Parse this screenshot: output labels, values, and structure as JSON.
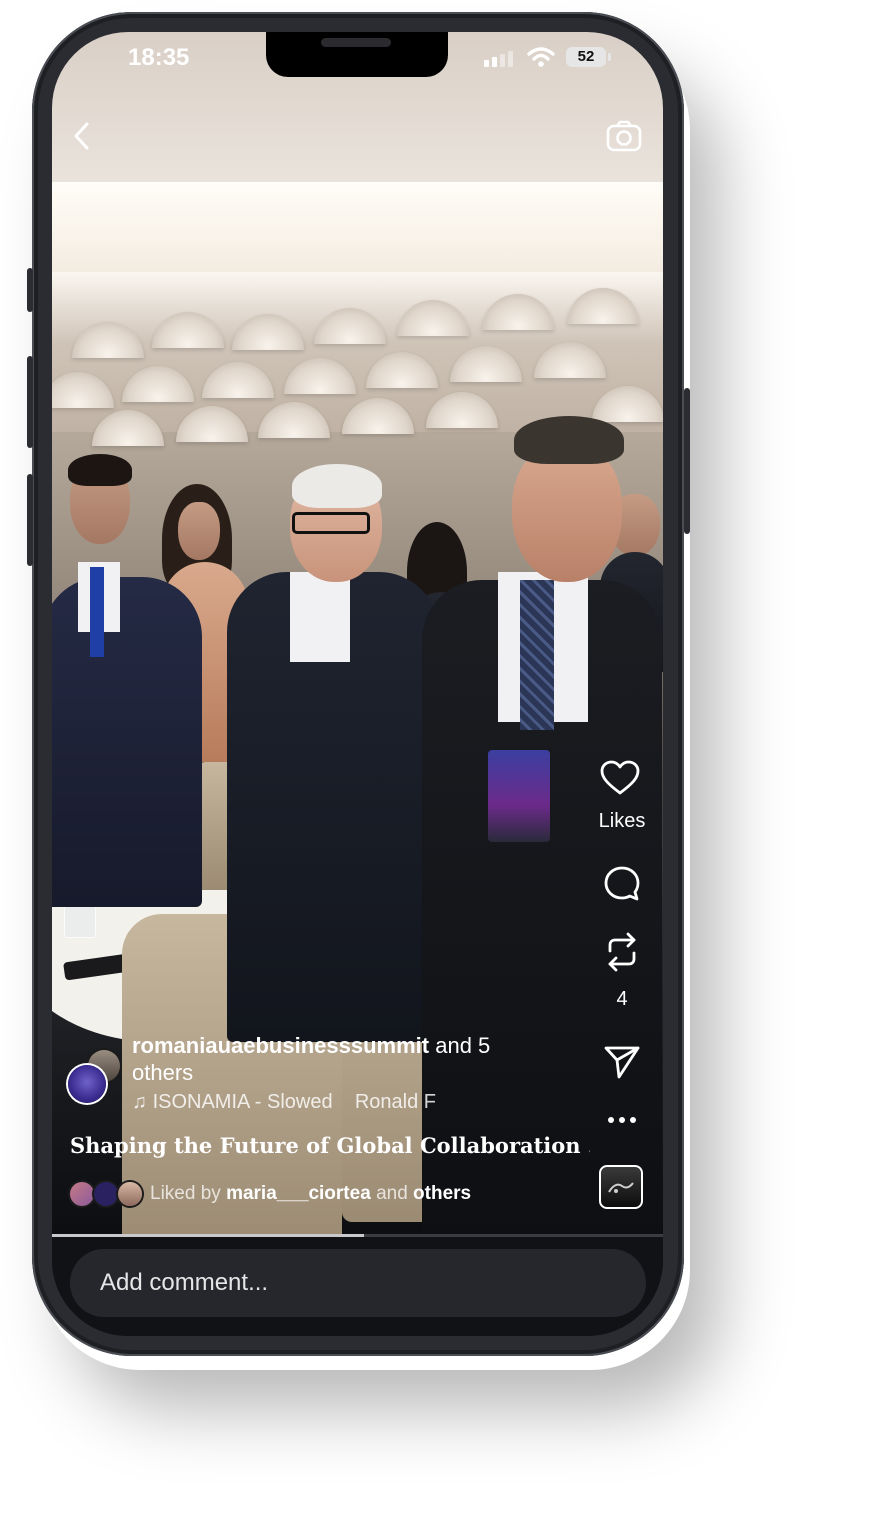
{
  "status_bar": {
    "time": "18:35",
    "battery": "52"
  },
  "header": {
    "back_icon": "chevron-left-icon",
    "camera_icon": "camera-icon"
  },
  "actions": {
    "like_label": "Likes",
    "repost_count": "4",
    "more_label": "···"
  },
  "post": {
    "author": "romaniauaebusinesssummit",
    "author_suffix": "and 5 others",
    "music": "ISONAMIA - Slowed    Ronald F",
    "caption": "Shaping the Future of Global Collaboration ...",
    "liked_prefix": "Liked by",
    "liked_user": "maria___ciortea",
    "liked_and": "and",
    "liked_others": "others"
  },
  "comment": {
    "placeholder": "Add comment..."
  },
  "progress": 0.51
}
